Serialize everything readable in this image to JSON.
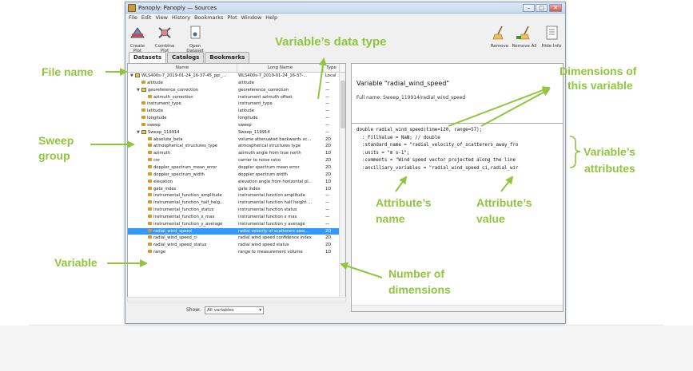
{
  "window": {
    "title": "Panoply: Panoply — Sources",
    "menu": [
      "File",
      "Edit",
      "View",
      "History",
      "Bookmarks",
      "Plot",
      "Window",
      "Help"
    ],
    "toolbar_left": [
      "Create Plot",
      "Combine Plot",
      "Open Dataset"
    ],
    "toolbar_right": [
      "Remove",
      "Remove All",
      "Hide Info"
    ],
    "tabs": [
      "Datasets",
      "Catalogs",
      "Bookmarks"
    ]
  },
  "tree": {
    "columns": [
      "Name",
      "Long Name",
      "Type"
    ],
    "rows": [
      {
        "name": "WLS400s-7_2019-01-24_16-37-45_ppi_...",
        "long": "WLS400s-7_2019-01-24_16-37-...",
        "type": "Local ...",
        "kind": "file",
        "indent": 0
      },
      {
        "name": "altitude",
        "long": "altitude",
        "type": "—",
        "kind": "var",
        "indent": 1
      },
      {
        "name": "georeference_correction",
        "long": "georeference_correction",
        "type": "—",
        "kind": "group",
        "indent": 1
      },
      {
        "name": "azimuth_correction",
        "long": "instrument azimuth offset",
        "type": "—",
        "kind": "var",
        "indent": 2
      },
      {
        "name": "instrument_type",
        "long": "instrument_type",
        "type": "—",
        "kind": "var",
        "indent": 1
      },
      {
        "name": "latitude",
        "long": "latitude",
        "type": "—",
        "kind": "var",
        "indent": 1
      },
      {
        "name": "longitude",
        "long": "longitude",
        "type": "—",
        "kind": "var",
        "indent": 1
      },
      {
        "name": "sweep",
        "long": "sweep",
        "type": "—",
        "kind": "var",
        "indent": 1
      },
      {
        "name": "Sweep_119914",
        "long": "Sweep_119914",
        "type": "—",
        "kind": "group",
        "indent": 1
      },
      {
        "name": "absolute_beta",
        "long": "volume attenuated backwards sc...",
        "type": "2D",
        "kind": "var",
        "indent": 2
      },
      {
        "name": "atmospherical_structures_type",
        "long": "atmospherical structures type",
        "type": "2D",
        "kind": "var",
        "indent": 2
      },
      {
        "name": "azimuth",
        "long": "azimuth angle from true north",
        "type": "1D",
        "kind": "var",
        "indent": 2
      },
      {
        "name": "cnr",
        "long": "carrier to noise ratio",
        "type": "2D",
        "kind": "var",
        "indent": 2
      },
      {
        "name": "doppler_spectrum_mean_error",
        "long": "doppler spectrum mean error",
        "type": "2D",
        "kind": "var",
        "indent": 2
      },
      {
        "name": "doppler_spectrum_width",
        "long": "doppler spectrum width",
        "type": "2D",
        "kind": "var",
        "indent": 2
      },
      {
        "name": "elevation",
        "long": "elevation angle from horizontal pl...",
        "type": "1D",
        "kind": "var",
        "indent": 2
      },
      {
        "name": "gate_index",
        "long": "gate index",
        "type": "1D",
        "kind": "var",
        "indent": 2
      },
      {
        "name": "instrumental_function_amplitude",
        "long": "instrumental function amplitude",
        "type": "—",
        "kind": "var",
        "indent": 2
      },
      {
        "name": "instrumental_function_half_heig...",
        "long": "instrumental function half height ...",
        "type": "—",
        "kind": "var",
        "indent": 2
      },
      {
        "name": "instrumental_function_status",
        "long": "instrumental function status",
        "type": "—",
        "kind": "var",
        "indent": 2
      },
      {
        "name": "instrumental_function_x_max",
        "long": "instrumental function x max",
        "type": "—",
        "kind": "var",
        "indent": 2
      },
      {
        "name": "instrumental_function_y_average",
        "long": "instrumental function y average",
        "type": "—",
        "kind": "var",
        "indent": 2
      },
      {
        "name": "radial_wind_speed",
        "long": "radial velocity of scatterers awa...",
        "type": "2D",
        "kind": "var",
        "indent": 2,
        "selected": true
      },
      {
        "name": "radial_wind_speed_ci",
        "long": "radial wind speed confidence index",
        "type": "2D",
        "kind": "var",
        "indent": 2
      },
      {
        "name": "radial_wind_speed_status",
        "long": "radial wind speed status",
        "type": "2D",
        "kind": "var",
        "indent": 2
      },
      {
        "name": "range",
        "long": "range to measurement volume",
        "type": "1D",
        "kind": "var",
        "indent": 2
      }
    ],
    "show_label": "Show:",
    "show_value": "All variables"
  },
  "info": {
    "title": "Variable \"radial_wind_speed\"",
    "full_name": "Full name: Sweep_119914/radial_wind_speed",
    "code": "double radial_wind_speed(time=120, range=57);\n  :_FillValue = NaN; // double\n  :standard_name = \"radial_velocity_of_scatterers_away_fro\n  :units = \"m s-1\";\n  :comments = \"Wind speed vector projected along the line\n  :ancilliary_variables = \"radial_wind_speed_ci,radial_wir"
  },
  "annotations": {
    "data_type": "Variable’s data type",
    "file_name": "File name",
    "dims_line1": "Dimensions of",
    "dims_line2": "this variable",
    "sweep_line1": "Sweep",
    "sweep_line2": "group",
    "attrs_line1": "Variable’s",
    "attrs_line2": "attributes",
    "attr_name_line1": "Attribute’s",
    "attr_name_line2": "name",
    "attr_value_line1": "Attribute’s",
    "attr_value_line2": "value",
    "variable": "Variable",
    "ndims_line1": "Number of",
    "ndims_line2": "dimensions"
  },
  "colors": {
    "annotation": "#8fc63e",
    "selection": "#3399ff"
  }
}
